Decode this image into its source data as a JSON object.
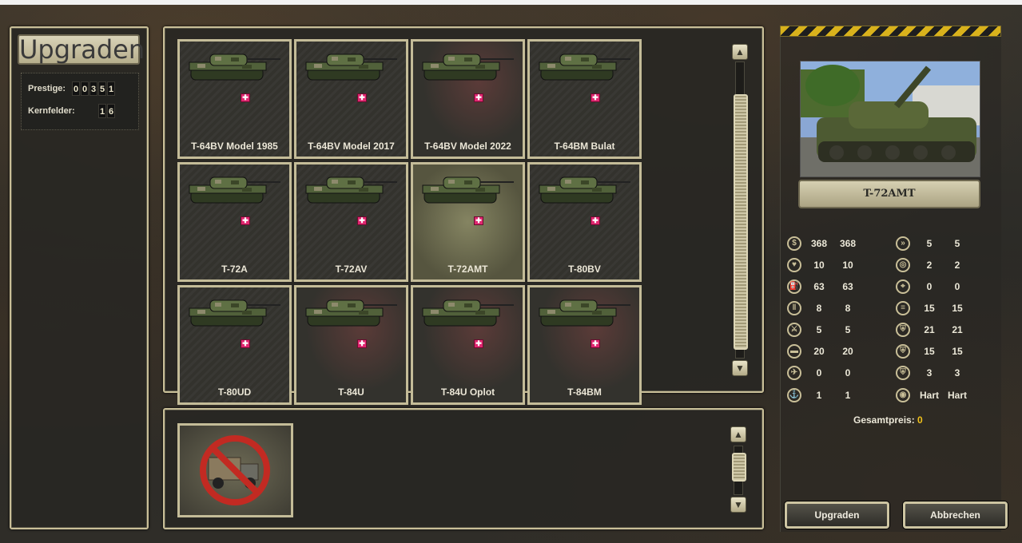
{
  "left_panel": {
    "title": "Upgraden",
    "prestige_label": "Prestige:",
    "prestige_digits": [
      "0",
      "0",
      "3",
      "5",
      "1"
    ],
    "core_label": "Kernfelder:",
    "core_digits": [
      "1",
      "6"
    ]
  },
  "units": [
    {
      "name": "T-64BV Model 1985",
      "flag": "✚"
    },
    {
      "name": "T-64BV Model 2017",
      "flag": "✚"
    },
    {
      "name": "T-64BV Model 2022",
      "flag": "✚"
    },
    {
      "name": "T-64BM Bulat",
      "flag": "✚"
    },
    {
      "name": "T-72A",
      "flag": "✚"
    },
    {
      "name": "T-72AV",
      "flag": "✚"
    },
    {
      "name": "T-72AMT",
      "flag": "✚"
    },
    {
      "name": "T-80BV",
      "flag": "✚"
    },
    {
      "name": "T-80UD",
      "flag": "✚"
    },
    {
      "name": "T-84U",
      "flag": "✚"
    },
    {
      "name": "T-84U Oplot",
      "flag": "✚"
    },
    {
      "name": "T-84BM",
      "flag": "✚"
    }
  ],
  "selected_unit": {
    "name": "T-72AMT"
  },
  "stats_left": [
    {
      "icon": "coins-icon",
      "a": "368",
      "b": "368"
    },
    {
      "icon": "heart-icon",
      "a": "10",
      "b": "10"
    },
    {
      "icon": "fuel-icon",
      "a": "63",
      "b": "63"
    },
    {
      "icon": "ammo-icon",
      "a": "8",
      "b": "8"
    },
    {
      "icon": "soft-attack-icon",
      "a": "5",
      "b": "5"
    },
    {
      "icon": "hard-attack-icon",
      "a": "20",
      "b": "20"
    },
    {
      "icon": "air-attack-icon",
      "a": "0",
      "b": "0"
    },
    {
      "icon": "naval-attack-icon",
      "a": "1",
      "b": "1"
    }
  ],
  "stats_right": [
    {
      "icon": "movement-icon",
      "a": "5",
      "b": "5"
    },
    {
      "icon": "spotting-icon",
      "a": "2",
      "b": "2"
    },
    {
      "icon": "range-icon",
      "a": "0",
      "b": "0"
    },
    {
      "icon": "initiative-icon",
      "a": "15",
      "b": "15"
    },
    {
      "icon": "ground-defense-icon",
      "a": "21",
      "b": "21"
    },
    {
      "icon": "air-defense-icon",
      "a": "15",
      "b": "15"
    },
    {
      "icon": "close-defense-icon",
      "a": "3",
      "b": "3"
    },
    {
      "icon": "target-type-icon",
      "a": "Hart",
      "b": "Hart"
    }
  ],
  "total_label": "Gesamtpreis:",
  "total_value": "0",
  "buttons": {
    "upgrade": "Upgraden",
    "cancel": "Abbrechen"
  },
  "colors": {
    "accent_gold": "#c9bf98",
    "total_value": "#f2c21b",
    "flag_pink": "#e0266f"
  }
}
